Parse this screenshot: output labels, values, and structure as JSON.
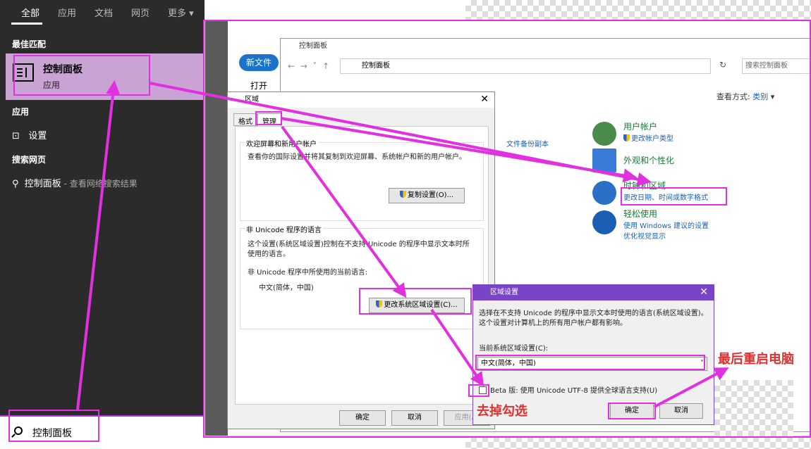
{
  "start": {
    "tabs": [
      "全部",
      "应用",
      "文档",
      "网页",
      "更多"
    ],
    "best_match_label": "最佳匹配",
    "best_match": {
      "title": "控制面板",
      "subtitle": "应用"
    },
    "apps_label": "应用",
    "settings": "设置",
    "web_label": "搜索网页",
    "web_item": "控制面板",
    "web_suffix": " - 查看网络搜索结果",
    "search_text": "控制面板"
  },
  "explorer": {
    "new_file": "新文件",
    "open": "打开"
  },
  "cpanel": {
    "title": "控制面板",
    "address": "控制面板",
    "search_placeholder": "搜索控制面板",
    "view_label": "查看方式:",
    "view_value": "类别",
    "backup_fragment": "文件备份副本",
    "categories": [
      {
        "title": "用户帐户",
        "link1": "更改帐户类型",
        "link2": ""
      },
      {
        "title": "外观和个性化",
        "link1": "",
        "link2": ""
      },
      {
        "title": "时钟和区域",
        "link1": "更改日期、时间或数字格式",
        "link2": ""
      },
      {
        "title": "轻松使用",
        "link1": "使用 Windows 建议的设置",
        "link2": "优化视觉显示"
      }
    ]
  },
  "region": {
    "title": "区域",
    "tab_format": "格式",
    "tab_admin": "管理",
    "group1_title": "欢迎屏幕和新用户帐户",
    "group1_text": "查看你的国际设置并将其复制到欢迎屏幕、系统帐户和新的用户帐户。",
    "copy_btn": "复制设置(O)...",
    "group2_title": "非 Unicode 程序的语言",
    "group2_text": "这个设置(系统区域设置)控制在不支持 Unicode 的程序中显示文本时所使用的语言。",
    "current_label": "非 Unicode 程序中所使用的当前语言:",
    "current_value": "中文(简体，中国)",
    "change_btn": "更改系统区域设置(C)...",
    "ok": "确定",
    "cancel": "取消",
    "apply": "应用(A)"
  },
  "rs": {
    "title": "区域设置",
    "desc": "选择在不支持 Unicode 的程序中显示文本时使用的语言(系统区域设置)。这个设置对计算机上的所有用户帐户都有影响。",
    "current_label": "当前系统区域设置(C):",
    "current_value": "中文(简体，中国)",
    "beta": "Beta 版: 使用 Unicode UTF-8 提供全球语言支持(U)",
    "ok": "确定",
    "cancel": "取消"
  },
  "annotations": {
    "uncheck": "去掉勾选",
    "restart": "最后重启电脑"
  }
}
